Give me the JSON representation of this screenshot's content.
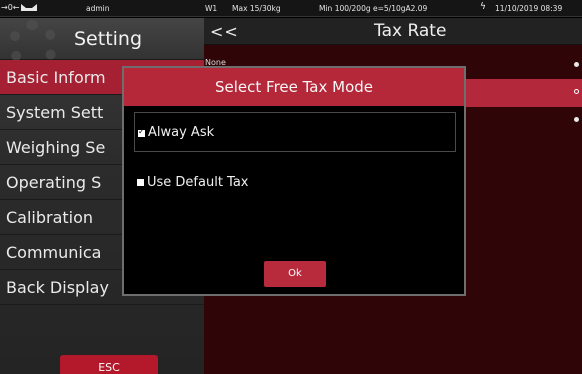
{
  "status_bar": {
    "indicator_text": "→0←",
    "user": "admin",
    "scale_id": "W1",
    "max": "Max 15/30kg",
    "min": "Min 100/200g e=5/10gA2.09",
    "power_icon": "bolt-icon",
    "datetime": "11/10/2019 08:39"
  },
  "sidebar": {
    "title": "Setting",
    "items": [
      {
        "label": "Basic Inform",
        "active": true
      },
      {
        "label": "System Sett",
        "active": false
      },
      {
        "label": "Weighing Se",
        "active": false
      },
      {
        "label": "Operating S",
        "active": false
      },
      {
        "label": "Calibration",
        "active": false
      },
      {
        "label": "Communica",
        "active": false
      },
      {
        "label": "Back Display",
        "active": false
      }
    ],
    "chevron": "›",
    "esc_label": "ESC"
  },
  "main": {
    "back_label": "<<",
    "title": "Tax Rate",
    "rows": [
      {
        "label": "None"
      },
      {
        "label": ""
      },
      {
        "label": ""
      }
    ]
  },
  "dialog": {
    "title": "Select Free Tax Mode",
    "options": [
      {
        "label": "Alway Ask",
        "checked": true
      },
      {
        "label": "Use Default Tax",
        "checked": false
      }
    ],
    "check_mark": "✓",
    "ok_label": "Ok"
  },
  "colors": {
    "accent_red": "#b5283a",
    "main_background": "#2f0507",
    "sidebar_background": "#2c2c2c"
  }
}
